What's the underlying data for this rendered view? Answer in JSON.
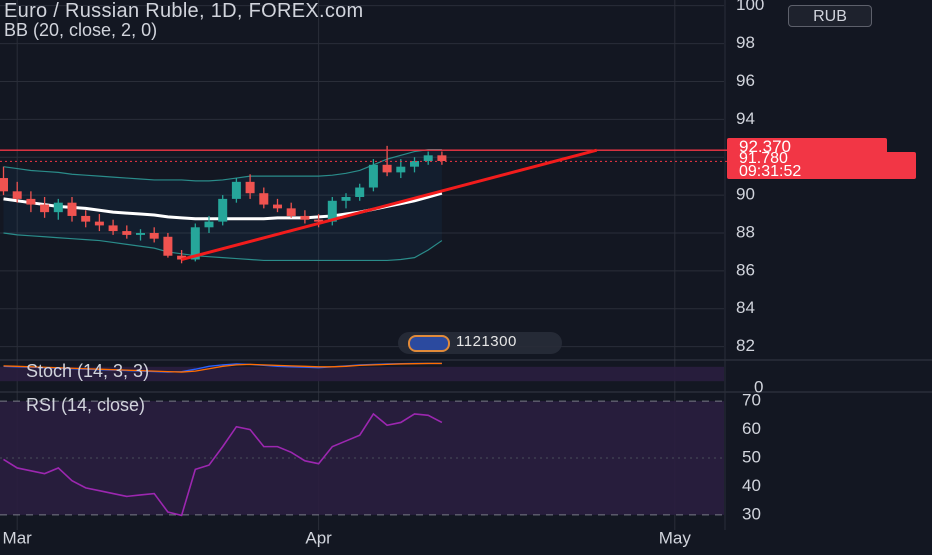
{
  "header": {
    "title": "Euro / Russian Ruble, 1D, FOREX.com",
    "bb_legend": "BB (20, close, 2, 0)",
    "currency_button": "RUB"
  },
  "badge": {
    "text": "1121300"
  },
  "price_tags": {
    "level": "92.370",
    "current": "91.780",
    "countdown": "09:31:52"
  },
  "colors": {
    "background": "#131722",
    "up": "#26a69a",
    "down": "#ef5350",
    "basis": "#ffffff",
    "band": "#2a8c8a",
    "trend": "#f21c1c",
    "pane": "#2a1e3f",
    "rsi_line": "#9c27b0"
  },
  "chart_data": [
    {
      "type": "candlestick",
      "title": "Euro / Russian Ruble, 1D, FOREX.com",
      "y_ticks": [
        82,
        84,
        86,
        88,
        90,
        92,
        94,
        96,
        98,
        100
      ],
      "y_tick_labels": [
        "82",
        "84",
        "86",
        "88",
        "90",
        "92",
        "94",
        "96",
        "98",
        "100"
      ],
      "ylim": [
        81.4,
        100.3
      ],
      "x_tick_labels": [
        {
          "label": "Mar",
          "index": 1
        },
        {
          "label": "Apr",
          "index": 23
        },
        {
          "label": "May",
          "index": 49
        }
      ],
      "n_slots": 54,
      "candles": [
        {
          "o": 90.9,
          "h": 91.5,
          "l": 90.0,
          "c": 90.2
        },
        {
          "o": 90.2,
          "h": 90.7,
          "l": 89.6,
          "c": 89.8
        },
        {
          "o": 89.8,
          "h": 90.2,
          "l": 89.1,
          "c": 89.5
        },
        {
          "o": 89.5,
          "h": 89.9,
          "l": 88.8,
          "c": 89.1
        },
        {
          "o": 89.1,
          "h": 89.8,
          "l": 88.7,
          "c": 89.6
        },
        {
          "o": 89.6,
          "h": 89.9,
          "l": 88.6,
          "c": 88.9
        },
        {
          "o": 88.9,
          "h": 89.2,
          "l": 88.3,
          "c": 88.6
        },
        {
          "o": 88.6,
          "h": 89.0,
          "l": 88.1,
          "c": 88.4
        },
        {
          "o": 88.4,
          "h": 88.7,
          "l": 87.9,
          "c": 88.1
        },
        {
          "o": 88.1,
          "h": 88.4,
          "l": 87.7,
          "c": 87.9
        },
        {
          "o": 87.9,
          "h": 88.2,
          "l": 87.6,
          "c": 88.0
        },
        {
          "o": 88.0,
          "h": 88.3,
          "l": 87.5,
          "c": 87.7
        },
        {
          "o": 87.8,
          "h": 88.0,
          "l": 86.7,
          "c": 86.8
        },
        {
          "o": 86.8,
          "h": 87.1,
          "l": 86.4,
          "c": 86.6
        },
        {
          "o": 86.6,
          "h": 88.5,
          "l": 86.5,
          "c": 88.3
        },
        {
          "o": 88.3,
          "h": 88.9,
          "l": 88.0,
          "c": 88.6
        },
        {
          "o": 88.6,
          "h": 90.0,
          "l": 88.4,
          "c": 89.8
        },
        {
          "o": 89.8,
          "h": 90.9,
          "l": 89.6,
          "c": 90.7
        },
        {
          "o": 90.7,
          "h": 91.1,
          "l": 89.8,
          "c": 90.1
        },
        {
          "o": 90.1,
          "h": 90.4,
          "l": 89.3,
          "c": 89.5
        },
        {
          "o": 89.5,
          "h": 89.8,
          "l": 89.1,
          "c": 89.3
        },
        {
          "o": 89.3,
          "h": 89.6,
          "l": 88.8,
          "c": 88.9
        },
        {
          "o": 88.9,
          "h": 89.2,
          "l": 88.5,
          "c": 88.7
        },
        {
          "o": 88.7,
          "h": 89.0,
          "l": 88.3,
          "c": 88.6
        },
        {
          "o": 88.6,
          "h": 89.9,
          "l": 88.4,
          "c": 89.7
        },
        {
          "o": 89.7,
          "h": 90.1,
          "l": 89.3,
          "c": 89.9
        },
        {
          "o": 89.9,
          "h": 90.6,
          "l": 89.7,
          "c": 90.4
        },
        {
          "o": 90.4,
          "h": 91.9,
          "l": 90.2,
          "c": 91.6
        },
        {
          "o": 91.6,
          "h": 92.6,
          "l": 91.0,
          "c": 91.2
        },
        {
          "o": 91.2,
          "h": 91.9,
          "l": 90.9,
          "c": 91.5
        },
        {
          "o": 91.5,
          "h": 92.0,
          "l": 91.2,
          "c": 91.8
        },
        {
          "o": 91.8,
          "h": 92.3,
          "l": 91.6,
          "c": 92.1
        },
        {
          "o": 92.1,
          "h": 92.3,
          "l": 91.6,
          "c": 91.8
        }
      ],
      "bb_basis": [
        89.8,
        89.7,
        89.6,
        89.5,
        89.4,
        89.35,
        89.3,
        89.2,
        89.1,
        89.05,
        89.0,
        88.95,
        88.85,
        88.8,
        88.75,
        88.75,
        88.75,
        88.75,
        88.75,
        88.75,
        88.8,
        88.8,
        88.8,
        88.85,
        88.9,
        89.0,
        89.1,
        89.25,
        89.4,
        89.55,
        89.7,
        89.9,
        90.1
      ],
      "bb_upper": [
        91.5,
        91.4,
        91.3,
        91.25,
        91.2,
        91.1,
        91.05,
        91.0,
        90.95,
        90.9,
        90.85,
        90.8,
        90.8,
        90.8,
        90.75,
        90.75,
        90.8,
        90.9,
        91.0,
        91.0,
        91.0,
        91.0,
        91.0,
        91.0,
        91.05,
        91.15,
        91.3,
        91.6,
        91.9,
        92.1,
        92.3,
        92.4,
        92.4
      ],
      "bb_lower": [
        88.0,
        87.9,
        87.85,
        87.8,
        87.75,
        87.7,
        87.65,
        87.6,
        87.5,
        87.4,
        87.3,
        87.2,
        87.0,
        86.9,
        86.8,
        86.75,
        86.7,
        86.65,
        86.6,
        86.55,
        86.55,
        86.55,
        86.55,
        86.55,
        86.55,
        86.55,
        86.55,
        86.55,
        86.55,
        86.6,
        86.7,
        87.1,
        87.6
      ],
      "horizontal_level": 92.37,
      "current_price": 91.78,
      "trendline": {
        "from": {
          "index": 13,
          "y": 86.6
        },
        "to": {
          "index": 43.3,
          "y": 92.37
        }
      }
    },
    {
      "type": "line",
      "title": "Stoch (14, 3, 3)",
      "y_ticks": [
        0
      ],
      "y_tick_labels": [
        "0"
      ],
      "ylim": [
        0,
        100
      ],
      "series": [
        {
          "values": [
            82,
            80,
            78,
            76,
            74,
            72,
            70,
            68,
            66,
            64,
            62,
            60,
            58,
            60,
            70,
            82,
            88,
            92,
            90,
            86,
            82,
            80,
            78,
            76,
            80,
            84,
            88,
            90,
            92,
            93,
            94,
            94,
            94
          ]
        },
        {
          "values": [
            84,
            82,
            80,
            78,
            76,
            74,
            72,
            70,
            68,
            66,
            64,
            62,
            60,
            58,
            62,
            72,
            82,
            88,
            90,
            88,
            86,
            84,
            82,
            80,
            80,
            82,
            86,
            88,
            90,
            92,
            93,
            94,
            94
          ]
        }
      ]
    },
    {
      "type": "line",
      "title": "RSI (14, close)",
      "y_ticks": [
        30,
        40,
        50,
        60,
        70
      ],
      "y_tick_labels": [
        "30",
        "40",
        "50",
        "60",
        "70"
      ],
      "ylim": [
        27.5,
        72.5
      ],
      "bands": [
        30,
        70
      ],
      "series": [
        {
          "values": [
            49.5,
            46.5,
            45.5,
            44.5,
            46.5,
            42.0,
            39.5,
            38.5,
            37.5,
            36.5,
            37.0,
            37.5,
            31.0,
            29.8,
            46.0,
            47.5,
            54.0,
            61.0,
            60.0,
            54.0,
            54.0,
            52.0,
            49.0,
            48.0,
            54.0,
            56.0,
            58.0,
            65.5,
            61.5,
            62.5,
            65.5,
            65.0,
            62.5
          ]
        }
      ]
    }
  ]
}
